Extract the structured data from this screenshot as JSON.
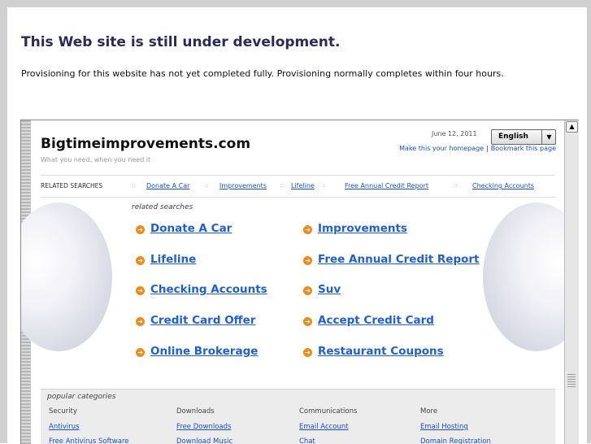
{
  "page": {
    "heading": "This Web site is still under development.",
    "message": "Provisioning for this website has not yet completed fully. Provisioning normally completes within four hours."
  },
  "preview": {
    "site_title": "Bigtimeimprovements.com",
    "tagline": "What you need, when you need it",
    "date": "June 12, 2011",
    "language": "English",
    "make_homepage": "Make this your homepage",
    "bookmark": "Bookmark this page",
    "related_label": "RELATED SEARCHES",
    "related_bar": [
      "Donate A Car",
      "Improvements",
      "Lifeline",
      "Free Annual Credit Report",
      "Checking Accounts"
    ],
    "related_heading": "related searches",
    "related_left": [
      "Donate A Car",
      "Lifeline",
      "Checking Accounts",
      "Credit Card Offer",
      "Online Brokerage"
    ],
    "related_right": [
      "Improvements",
      "Free Annual Credit Report",
      "Suv",
      "Accept Credit Card",
      "Restaurant Coupons"
    ],
    "popular_heading": "popular categories",
    "categories": [
      {
        "title": "Security",
        "links": [
          "Antivirus",
          "Free Antivirus Software"
        ]
      },
      {
        "title": "Downloads",
        "links": [
          "Free Downloads",
          "Download Music"
        ]
      },
      {
        "title": "Communications",
        "links": [
          "Email Account",
          "Chat"
        ]
      },
      {
        "title": "More",
        "links": [
          "Email Hosting",
          "Domain Registration"
        ]
      }
    ],
    "accent_color": "#1f5fd6",
    "bullet_color": "#ec8b1a"
  }
}
